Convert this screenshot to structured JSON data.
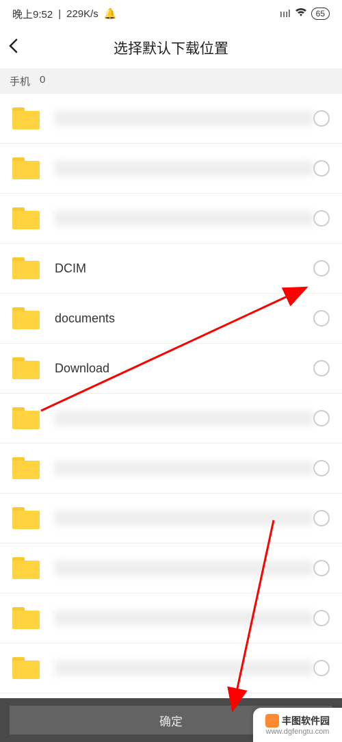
{
  "status": {
    "time": "晚上9:52",
    "speed": "229K/s",
    "battery": "65"
  },
  "header": {
    "title": "选择默认下载位置"
  },
  "breadcrumb": {
    "root": "手机",
    "path": "0"
  },
  "folders": [
    {
      "name": "",
      "blurred": true,
      "cls": "w1"
    },
    {
      "name": "",
      "blurred": true,
      "cls": "w2"
    },
    {
      "name": "",
      "blurred": true,
      "cls": "w3"
    },
    {
      "name": "DCIM",
      "blurred": false
    },
    {
      "name": "documents",
      "blurred": false
    },
    {
      "name": "Download",
      "blurred": false
    },
    {
      "name": "",
      "blurred": true,
      "cls": "w4"
    },
    {
      "name": "",
      "blurred": true,
      "cls": "w4"
    },
    {
      "name": "",
      "blurred": true,
      "cls": "w3"
    },
    {
      "name": "i",
      "blurred": true,
      "cls": "w4"
    },
    {
      "name": "i",
      "blurred": true,
      "cls": "w3"
    },
    {
      "name": "",
      "blurred": true,
      "cls": "w4"
    }
  ],
  "bottom": {
    "confirm": "确定"
  },
  "watermark": {
    "brand": "丰图软件园",
    "url": "www.dgfengtu.com"
  },
  "annotation": {
    "arrow_to_radio": "DCIM radio target",
    "arrow_to_confirm": "confirm button target"
  }
}
